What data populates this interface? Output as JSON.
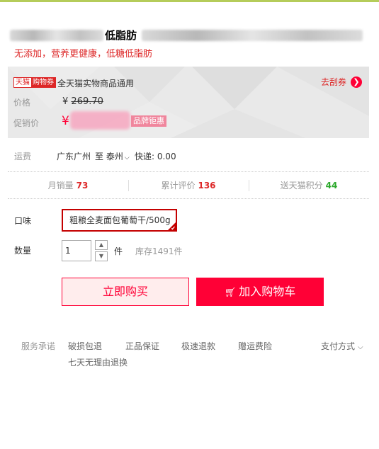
{
  "title": {
    "visible_text": "低脂肪",
    "subtitle": "无添加，营养更健康，低糖低脂肪"
  },
  "coupon": {
    "badge_left": "天猫",
    "badge_right": "购物券",
    "text": "全天猫实物商品通用",
    "link": "去刮券",
    "link_icon": "chevron-right-icon"
  },
  "price": {
    "label": "价格",
    "currency": "¥",
    "value": "269.70"
  },
  "promo_price": {
    "label": "促销价",
    "currency": "¥",
    "tag": "品牌钜惠"
  },
  "shipping": {
    "label": "运费",
    "from": "广东广州",
    "to": "至 泰州",
    "fee": "快递: 0.00"
  },
  "stats": [
    {
      "label": "月销量",
      "value": "73"
    },
    {
      "label": "累计评价",
      "value": "136"
    },
    {
      "label": "送天猫积分",
      "value": "44"
    }
  ],
  "flavor": {
    "label": "口味",
    "option": "粗粮全麦面包葡萄干/500g"
  },
  "quantity": {
    "label": "数量",
    "value": "1",
    "unit": "件",
    "stock": "库存1491件"
  },
  "actions": {
    "buy_now": "立即购买",
    "add_cart": "加入购物车"
  },
  "services": {
    "label": "服务承诺",
    "items": [
      "破损包退",
      "正品保证",
      "极速退款",
      "赠运费险",
      "七天无理由退换"
    ],
    "payment": "支付方式"
  },
  "colors": {
    "accent": "#ff0036",
    "brand_red": "#dd2727",
    "points_green": "#2ba82b",
    "top_line": "#b5cc5a"
  }
}
